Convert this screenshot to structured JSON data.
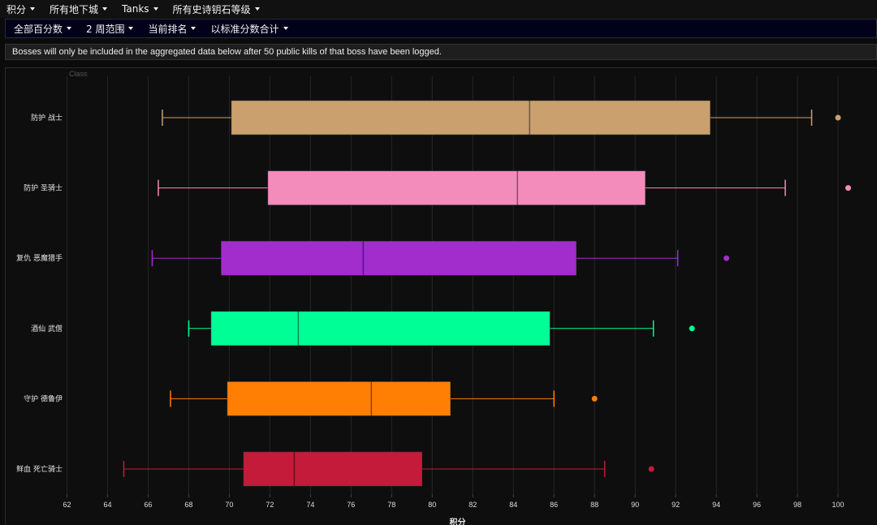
{
  "nav_primary": [
    {
      "label": "积分"
    },
    {
      "label": "所有地下城"
    },
    {
      "label": "Tanks"
    },
    {
      "label": "所有史诗钥石等级"
    }
  ],
  "nav_secondary": [
    {
      "label": "全部百分数"
    },
    {
      "label": "2 周范围"
    },
    {
      "label": "当前排名"
    },
    {
      "label": "以标准分数合计"
    }
  ],
  "notice": "Bosses will only be included in the aggregated data below after 50 public kills of that boss have been logged.",
  "chart_data": {
    "type": "boxplot",
    "orientation": "horizontal",
    "xlabel": "积分",
    "ylabel": "Class",
    "xlim": [
      61.5,
      101
    ],
    "xticks": [
      62,
      64,
      66,
      68,
      70,
      72,
      74,
      76,
      78,
      80,
      82,
      84,
      86,
      88,
      90,
      92,
      94,
      96,
      98,
      100
    ],
    "grid": true,
    "series": [
      {
        "name": "防护 战士",
        "color": "#c9a06e",
        "whisker_low": 66.7,
        "q1": 70.1,
        "median": 84.8,
        "q3": 93.7,
        "whisker_high": 98.7,
        "outliers": [
          100.0
        ]
      },
      {
        "name": "防护 圣骑士",
        "color": "#f38bbb",
        "whisker_low": 66.5,
        "q1": 71.9,
        "median": 84.2,
        "q3": 90.5,
        "whisker_high": 97.4,
        "outliers": [
          100.5
        ]
      },
      {
        "name": "复仇 恶魔猎手",
        "color": "#a32ccd",
        "whisker_low": 66.2,
        "q1": 69.6,
        "median": 76.6,
        "q3": 87.1,
        "whisker_high": 92.1,
        "outliers": [
          94.5
        ]
      },
      {
        "name": "酒仙 武僧",
        "color": "#00fe96",
        "whisker_low": 68.0,
        "q1": 69.1,
        "median": 73.4,
        "q3": 85.8,
        "whisker_high": 90.9,
        "outliers": [
          92.8
        ]
      },
      {
        "name": "守护 德鲁伊",
        "color": "#fe7f03",
        "whisker_low": 67.1,
        "q1": 69.9,
        "median": 77.0,
        "q3": 80.9,
        "whisker_high": 86.0,
        "outliers": [
          88.0
        ]
      },
      {
        "name": "鲜血 死亡骑士",
        "color": "#c41b3a",
        "whisker_low": 64.8,
        "q1": 70.7,
        "median": 73.2,
        "q3": 79.5,
        "whisker_high": 88.5,
        "outliers": [
          90.8
        ]
      }
    ]
  }
}
